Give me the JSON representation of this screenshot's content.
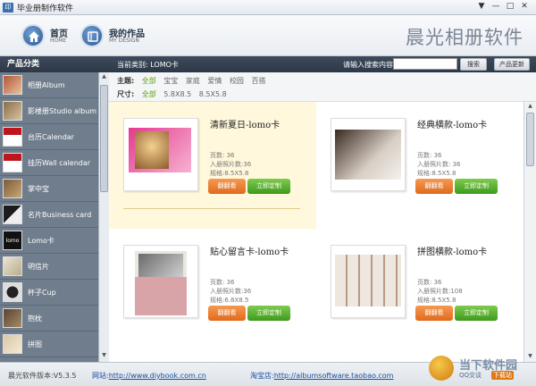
{
  "window": {
    "title": "毕业册制作软件",
    "app_icon": "印"
  },
  "nav": [
    {
      "label": "首页",
      "sub": "HOME",
      "icon": "home-icon"
    },
    {
      "label": "我的作品",
      "sub": "MY DESIGN",
      "icon": "book-icon"
    }
  ],
  "brand": "晨光相册软件",
  "sidebar": {
    "heading": "产品分类",
    "items": [
      {
        "label": "相册Album"
      },
      {
        "label": "影楼册Studio album"
      },
      {
        "label": "台历Calendar"
      },
      {
        "label": "挂历Wall calendar"
      },
      {
        "label": "掌中宝"
      },
      {
        "label": "名片Business card"
      },
      {
        "label": "Lomo卡"
      },
      {
        "label": "明信片"
      },
      {
        "label": "杯子Cup"
      },
      {
        "label": "抱枕"
      },
      {
        "label": "拼图"
      }
    ]
  },
  "topbar": {
    "current_label": "当前类别: LOMO卡",
    "search_label": "请输入搜索内容:",
    "search_value": "",
    "search_button": "搜索",
    "update_button": "产品更新"
  },
  "filters": {
    "theme_label": "主题:",
    "themes": [
      "全部",
      "宝宝",
      "家庭",
      "爱情",
      "校园",
      "百搭"
    ],
    "size_label": "尺寸:",
    "sizes": [
      "全部",
      "5.8X8.5",
      "8.5X5.8"
    ]
  },
  "cards": [
    {
      "name": "清新夏日-lomo卡",
      "pages": "页数: 36",
      "photos": "入册照片数:36",
      "spec": "规格:8.5X5.8",
      "browse": "翻翻看",
      "customize": "立即定制"
    },
    {
      "name": "经典横款-lomo卡",
      "pages": "页数: 36",
      "photos": "入册照片数: 36",
      "spec": "规格:8.5X5.8",
      "browse": "翻翻看",
      "customize": "立即定制"
    },
    {
      "name": "贴心留言卡-lomo卡",
      "pages": "页数: 36",
      "photos": "入册照片数:36",
      "spec": "规格:6.8X8.5",
      "browse": "翻翻看",
      "customize": "立即定制"
    },
    {
      "name": "拼图横款-lomo卡",
      "pages": "页数: 36",
      "photos": "入册照片数:108",
      "spec": "规格:8.5X5.8",
      "browse": "翻翻看",
      "customize": "立即定制"
    }
  ],
  "footer": {
    "version": "晨光软件版本:V5.3.5",
    "site_label": "网站:",
    "site_url": "http://www.diybook.com.cn",
    "shop_label": "淘宝店:",
    "shop_url": "http://albumsoftware.taobao.com"
  },
  "watermark": {
    "title": "当下软件园",
    "sub": "QQ交谈",
    "tag": "下载站"
  }
}
